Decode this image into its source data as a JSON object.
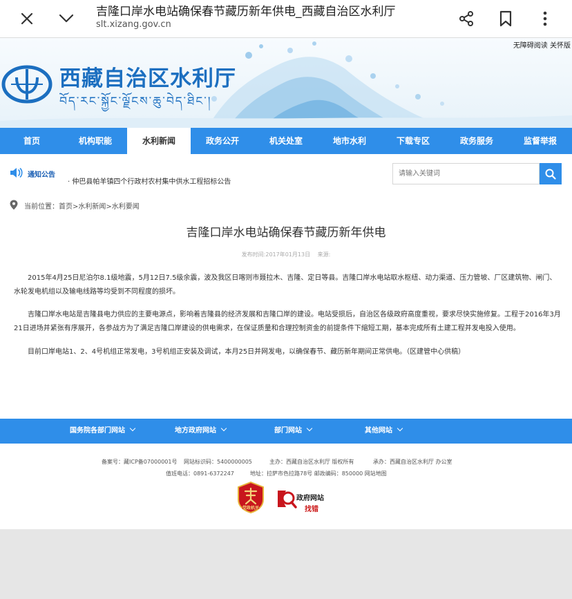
{
  "browser": {
    "page_title": "吉隆口岸水电站确保春节藏历新年供电_西藏自治区水利厅",
    "url": "slt.xizang.gov.cn",
    "icons": [
      "close-icon",
      "chevron-down-icon",
      "share-icon",
      "bookmark-icon",
      "more-vertical-icon"
    ]
  },
  "banner": {
    "accessibility_links": "无障碍阅读 关怀版",
    "site_title": "西藏自治区水利厅",
    "tibetan_title": "བོད་རང་སྐྱོང་ལྗོངས་ཆུ་བེད་ཐིང་།"
  },
  "nav": {
    "items": [
      "首页",
      "机构职能",
      "水利新闻",
      "政务公开",
      "机关处室",
      "地市水利",
      "下载专区",
      "政务服务",
      "监督举报"
    ],
    "active_index": 2
  },
  "notice": {
    "label": "通知公告",
    "text": "· 仲巴县帕羊镇四个行政村农村集中供水工程招标公告"
  },
  "search": {
    "placeholder": "请输入关键词"
  },
  "breadcrumb": {
    "text": "当前位置：首页>水利新闻>水利要闻"
  },
  "article": {
    "title": "吉隆口岸水电站确保春节藏历新年供电",
    "publish_time": "发布时间:2017年01月13日",
    "source": "来源:",
    "paragraphs": [
      "2015年4月25日尼泊尔8.1级地震，5月12日7.5级余震，波及我区日喀则市聂拉木、吉隆、定日等县。吉隆口岸水电站取水枢纽、动力渠道、压力管坡、厂区建筑物、闸门、水轮发电机组以及输电线路等均受到不同程度的损坏。",
      "吉隆口岸水电站是吉隆县电力供应的主要电源点，影响着吉隆县的经济发展和吉隆口岸的建设。电站受损后，自治区各级政府高度重视，要求尽快实施修复。工程于2016年3月21日进场并紧张有序展开，各参战方为了满足吉隆口岸建设的供电需求，在保证质量和合理控制资金的前提条件下缩短工期，基本完成所有土建工程并发电投入使用。",
      "目前口岸电站1、2、4号机组正常发电，3号机组正安装及调试，本月25日并网发电，以确保春节、藏历新年期间正常供电。（区建管中心供稿）"
    ]
  },
  "footer": {
    "link_groups": [
      "国务院各部门网站",
      "地方政府网站",
      "部门网站",
      "其他网站"
    ],
    "record_no": "备案号：藏ICP备07000001号",
    "site_id": "网站标识码：5400000005",
    "sponsor": "主办：西藏自治区水利厅 版权所有",
    "organizer": "承办：西藏自治区水利厅 办公室",
    "phone": "值班电话：0891-6372247",
    "address": "地址：拉萨市色拉路78号 邮政编码：850000 网站地图",
    "badge_party": "党政机关",
    "gov_site_label": "政府网站",
    "report_error": "找错"
  },
  "colors": {
    "accent_blue": "#2f8ee9",
    "title_blue": "#1c6fc0",
    "error_red": "#cc1a1a"
  }
}
